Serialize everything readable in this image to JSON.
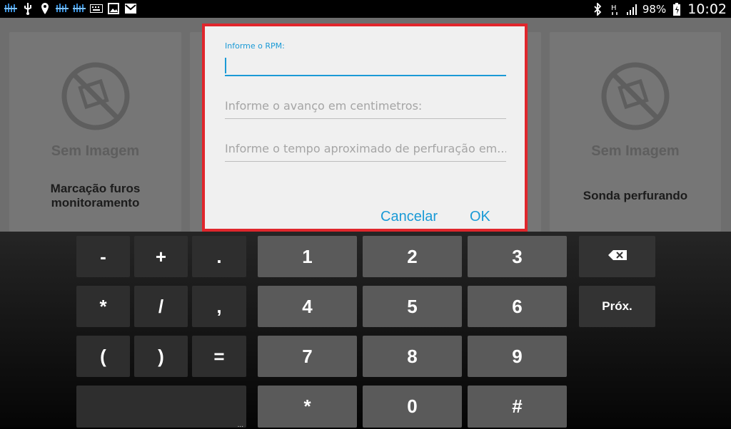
{
  "status_bar": {
    "battery_percent": "98%",
    "time": "10:02",
    "left_icons": [
      "signal-scan-icon",
      "usb-icon",
      "location-icon",
      "signal-scan-icon",
      "signal-scan-icon",
      "keyboard-icon",
      "image-icon",
      "mail-icon"
    ],
    "right_icons": [
      "bluetooth-icon",
      "network-h-icon",
      "signal-bars-icon",
      "battery-icon"
    ]
  },
  "background_cards": [
    {
      "image_placeholder": "Sem Imagem",
      "title_line1": "Marcação furos",
      "title_line2": "monitoramento"
    },
    {
      "image_placeholder": "Sem Imagem",
      "title_line1": "Sonda perfurando",
      "title_line2": ""
    }
  ],
  "dialog": {
    "rpm_label": "Informe o RPM:",
    "rpm_value": "",
    "advance_placeholder": "Informe o avanço em centimetros:",
    "time_placeholder": "Informe o tempo aproximado de perfuração em...",
    "cancel_label": "Cancelar",
    "ok_label": "OK",
    "border_color": "#e0262c",
    "accent_color": "#1a9ad6"
  },
  "keyboard": {
    "symbols": [
      [
        "-",
        "+",
        "."
      ],
      [
        "*",
        "/",
        ","
      ],
      [
        "(",
        ")",
        "="
      ]
    ],
    "digits": [
      [
        "1",
        "2",
        "3"
      ],
      [
        "4",
        "5",
        "6"
      ],
      [
        "7",
        "8",
        "9"
      ],
      [
        "*",
        "0",
        "#"
      ]
    ],
    "next_label": "Próx.",
    "space_hint": "..."
  }
}
